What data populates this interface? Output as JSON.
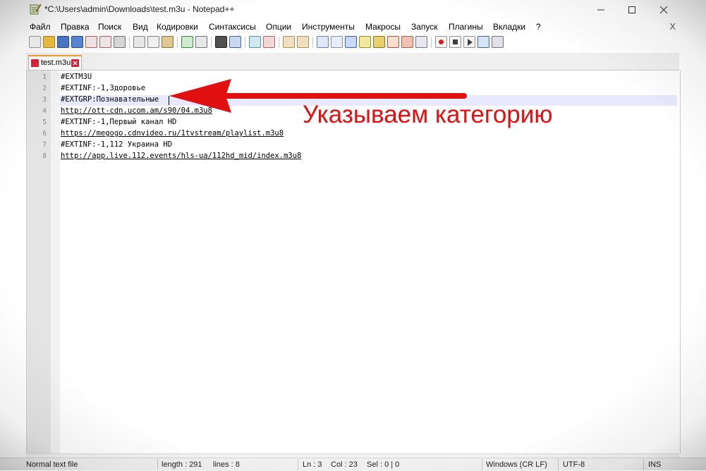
{
  "window": {
    "title": "*C:\\Users\\admin\\Downloads\\test.m3u - Notepad++",
    "icon": "notepad-plus-icon"
  },
  "menu": {
    "items": [
      "Файл",
      "Правка",
      "Поиск",
      "Вид",
      "Кодировки",
      "Синтаксисы",
      "Опции",
      "Инструменты",
      "Макросы",
      "Запуск",
      "Плагины",
      "Вкладки",
      "?"
    ],
    "close_label": "X"
  },
  "toolbar": {
    "buttons": [
      "new-file-icon",
      "open-file-icon",
      "save-icon",
      "save-all-icon",
      "close-icon",
      "close-all-icon",
      "print-icon",
      "cut-icon",
      "copy-icon",
      "paste-icon",
      "undo-icon",
      "redo-icon",
      "find-icon",
      "replace-icon",
      "zoom-in-icon",
      "zoom-out-icon",
      "sync-vertical-icon",
      "sync-horizontal-icon",
      "word-wrap-icon",
      "show-all-chars-icon",
      "indent-guide-icon",
      "user-lang-icon",
      "doc-map-icon",
      "function-list-icon",
      "folder-workspace-icon",
      "monitoring-icon",
      "record-macro-icon",
      "stop-record-icon",
      "play-macro-icon",
      "run-macro-multiple-icon",
      "save-macro-icon"
    ]
  },
  "tab": {
    "label": "test.m3u",
    "state": "modified"
  },
  "editor": {
    "lines": [
      {
        "num": "1",
        "text": "#EXTM3U",
        "link": false
      },
      {
        "num": "2",
        "text": "#EXTINF:-1,Здоровье",
        "link": false
      },
      {
        "num": "3",
        "text": "#EXTGRP:Познавательные",
        "link": false
      },
      {
        "num": "4",
        "text": "http://ott-cdn.ucom.am/s90/04.m3u8",
        "link": true
      },
      {
        "num": "5",
        "text": "#EXTINF:-1,Первый канал HD",
        "link": false
      },
      {
        "num": "6",
        "text": "https://megogo.cdnvideo.ru/1tvstream/playlist.m3u8",
        "link": true
      },
      {
        "num": "7",
        "text": "#EXTINF:-1,112 Украина HD",
        "link": false
      },
      {
        "num": "8",
        "text": "http://app.live.112.events/hls-ua/112hd_mid/index.m3u8",
        "link": true
      }
    ],
    "current_line": 3
  },
  "status": {
    "file_type": "Normal text file",
    "length": "length : 291",
    "lines": "lines : 8",
    "position": "Ln : 3",
    "column": "Col : 23",
    "selection": "Sel : 0 | 0",
    "eol": "Windows (CR LF)",
    "encoding": "UTF-8",
    "mode": "INS"
  },
  "annotation": {
    "text": "Указываем категорию",
    "color": "#e01010"
  }
}
